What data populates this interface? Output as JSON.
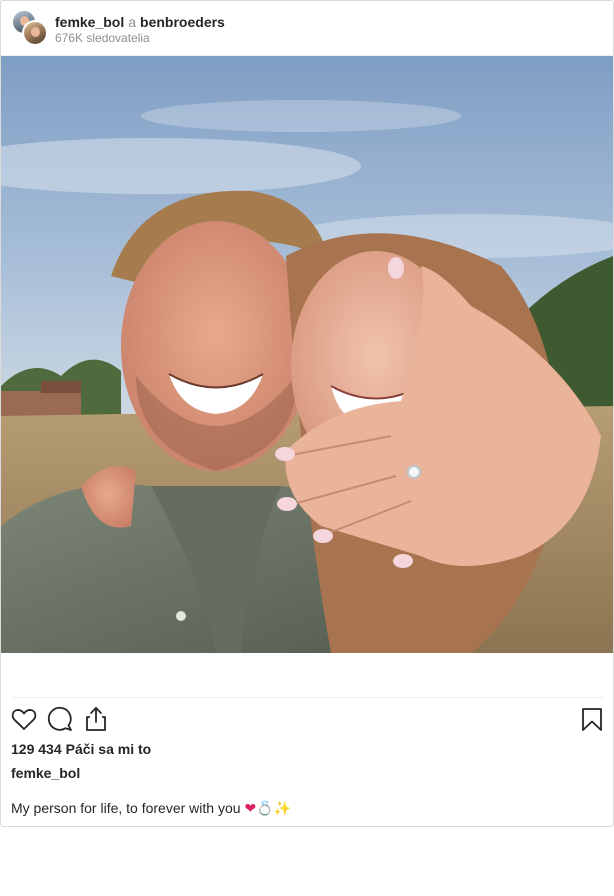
{
  "post": {
    "author_primary": "femke_bol",
    "conjunction": "a",
    "author_secondary": "benbroeders",
    "followers": "676K sledovatelia",
    "likes_count": "129 434",
    "likes_label": "Páči sa mi to",
    "caption_author": "femke_bol",
    "caption_text": "My person for life, to forever with you",
    "caption_emojis": [
      "❤",
      "💍",
      "✨"
    ]
  },
  "icons": {
    "like": "heart-outline-icon",
    "comment": "comment-bubble-icon",
    "share": "share-icon",
    "save": "bookmark-icon"
  },
  "colors": {
    "text": "#262626",
    "muted": "#8e8e8e",
    "border": "#dbdbdb"
  }
}
